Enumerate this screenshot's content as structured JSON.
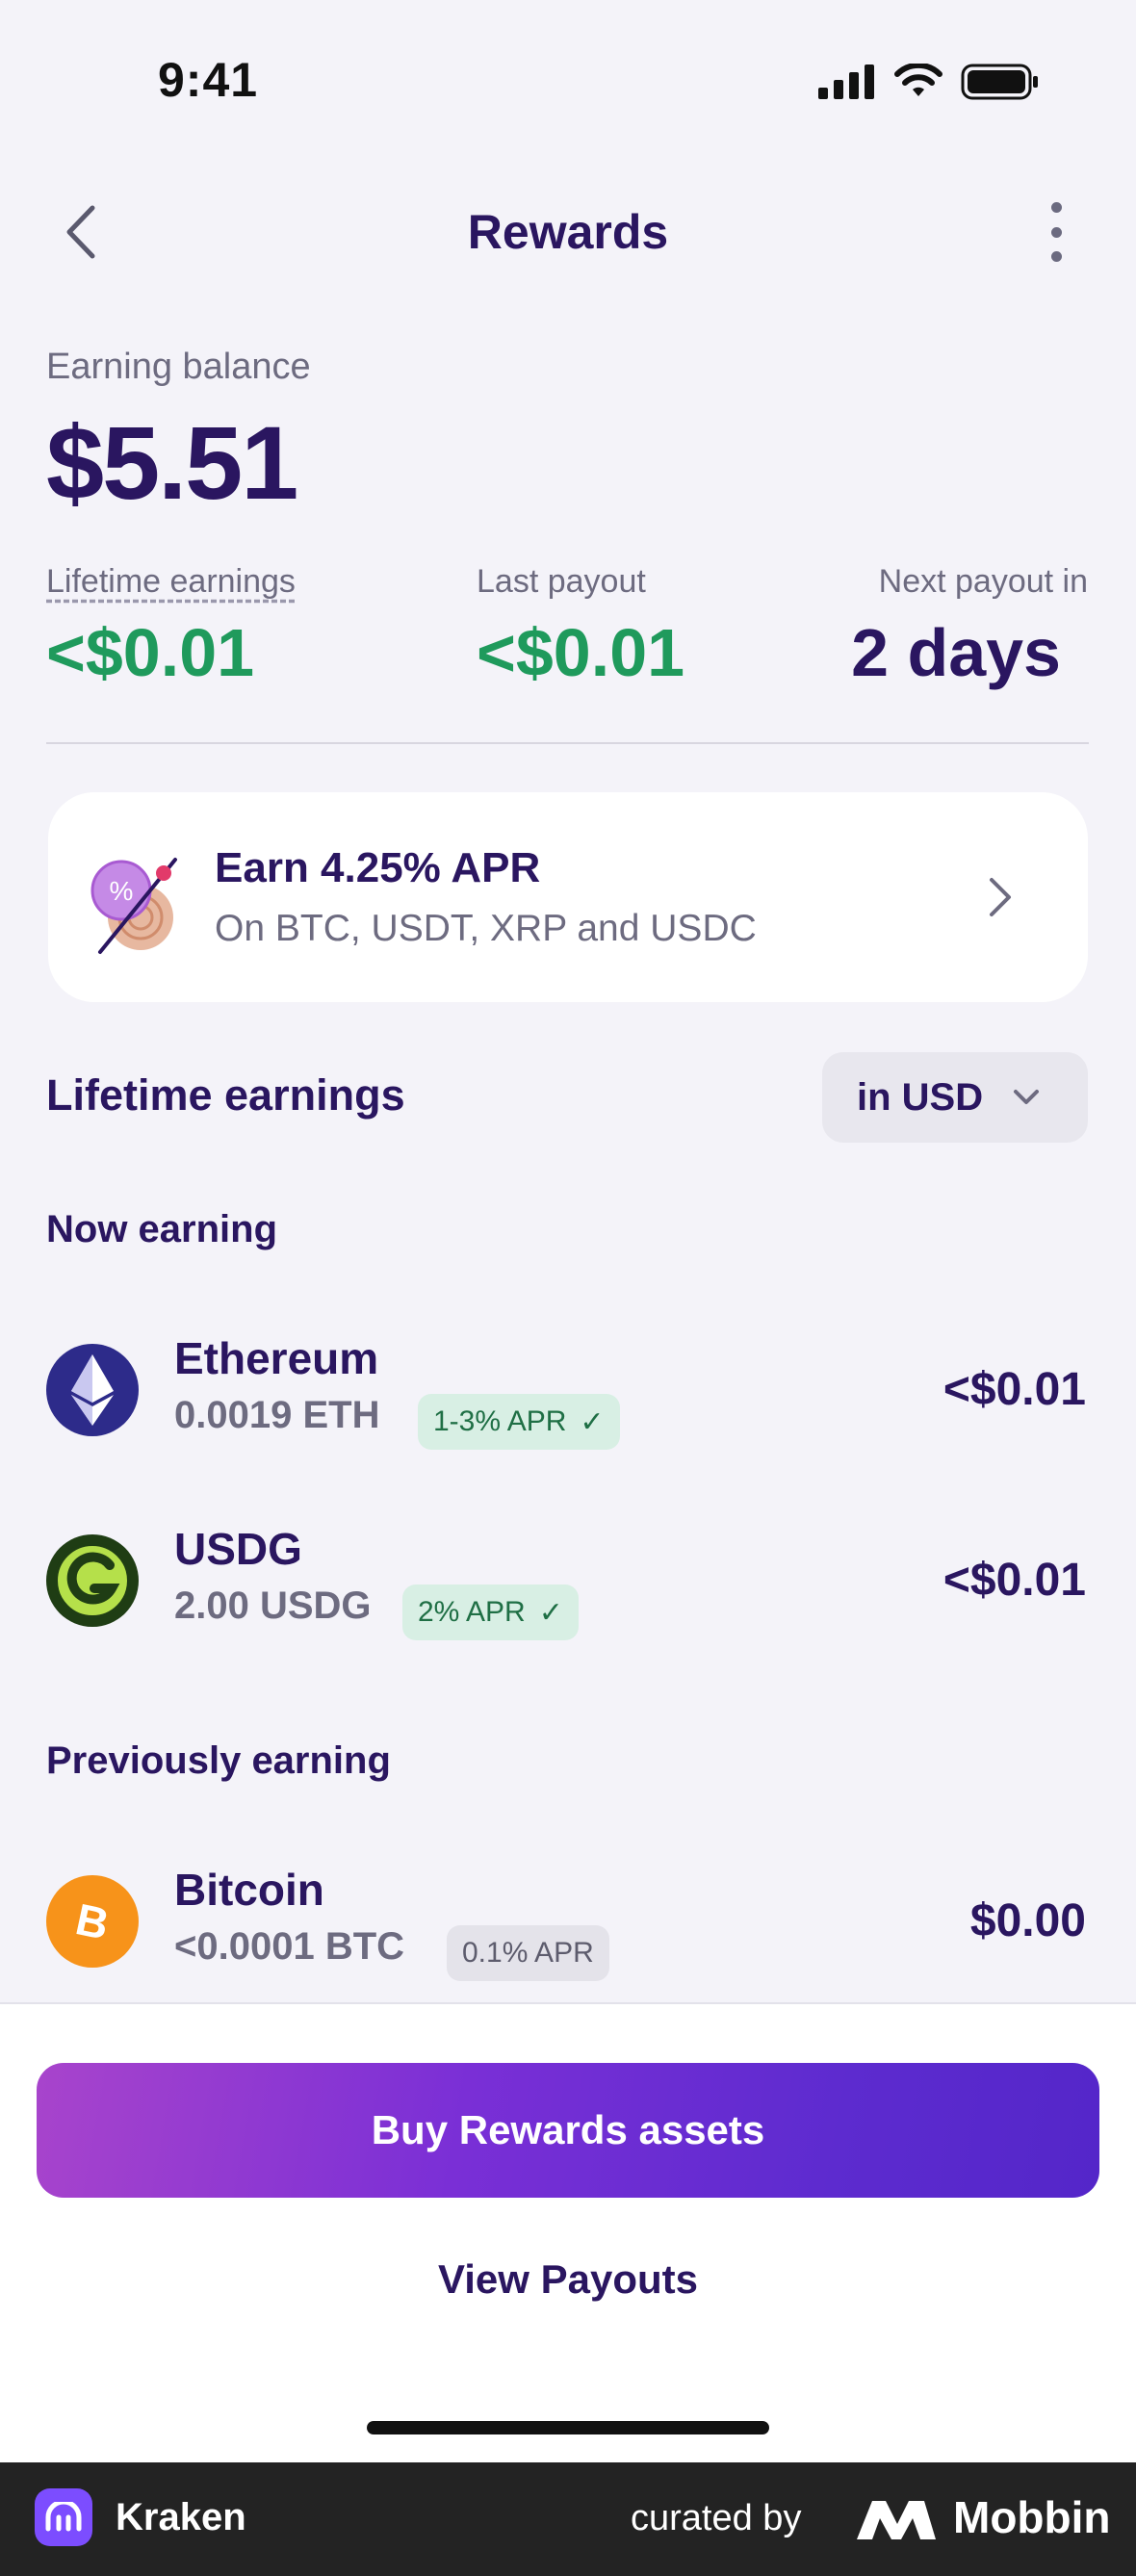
{
  "status_bar": {
    "time": "9:41"
  },
  "header": {
    "title": "Rewards"
  },
  "balance": {
    "label": "Earning balance",
    "value": "$5.51"
  },
  "stats": {
    "lifetime_label": "Lifetime earnings",
    "lifetime_value": "<$0.01",
    "last_label": "Last payout",
    "last_value": "<$0.01",
    "next_label": "Next payout in",
    "next_value": "2 days"
  },
  "promo": {
    "title": "Earn 4.25% APR",
    "subtitle": "On BTC, USDT, XRP and USDC"
  },
  "earnings": {
    "title": "Lifetime earnings",
    "currency": "in USD"
  },
  "now_earning": {
    "header": "Now earning",
    "assets": [
      {
        "name": "Ethereum",
        "amount": "0.0019 ETH",
        "apr": "1-3% APR",
        "value": "<$0.01"
      },
      {
        "name": "USDG",
        "amount": "2.00 USDG",
        "apr": "2% APR",
        "value": "<$0.01"
      }
    ]
  },
  "previously_earning": {
    "header": "Previously earning",
    "assets": [
      {
        "name": "Bitcoin",
        "amount": "<0.0001 BTC",
        "apr": "0.1% APR",
        "value": "$0.00"
      }
    ]
  },
  "actions": {
    "buy": "Buy Rewards assets",
    "view_payouts": "View Payouts"
  },
  "footer": {
    "app_name": "Kraken",
    "curated_by": "curated by",
    "brand": "Mobbin"
  },
  "colors": {
    "accent": "#5d2bcf",
    "positive": "#1f9a5c",
    "text": "#2a1660"
  }
}
